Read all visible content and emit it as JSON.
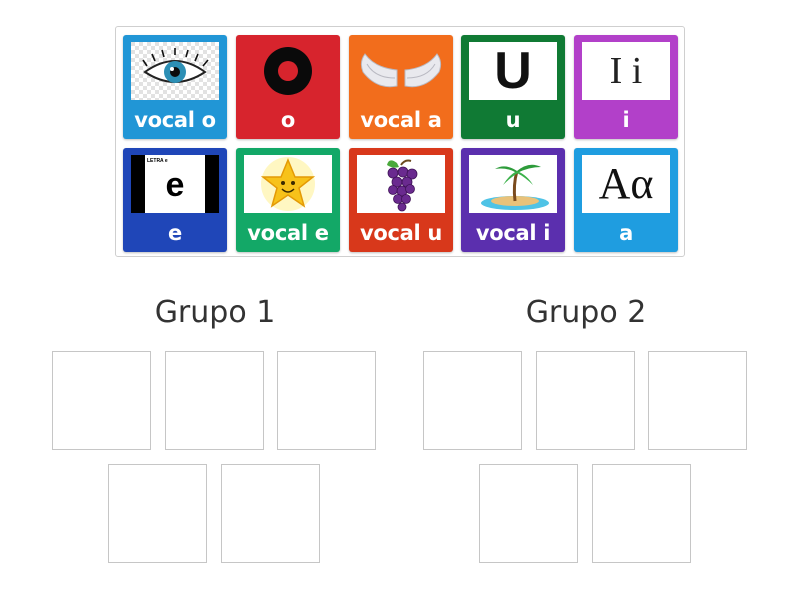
{
  "tiles": [
    {
      "label": "vocal o",
      "color": "#2196d6",
      "icon": "eye-icon"
    },
    {
      "label": "o",
      "color": "#d7242d",
      "icon": "letter-o-ring-icon"
    },
    {
      "label": "vocal a",
      "color": "#f26d1c",
      "icon": "angel-wings-icon"
    },
    {
      "label": "u",
      "color": "#107a34",
      "icon": "letter-u-icon",
      "glyph": "U"
    },
    {
      "label": "i",
      "color": "#b240c9",
      "icon": "letter-i-icon",
      "glyph": "I i"
    },
    {
      "label": "e",
      "color": "#1f46b8",
      "icon": "letter-e-card-icon",
      "glyph": "e",
      "small_text": "LETRA e"
    },
    {
      "label": "vocal e",
      "color": "#13a867",
      "icon": "star-icon"
    },
    {
      "label": "vocal u",
      "color": "#d8381b",
      "icon": "grapes-icon"
    },
    {
      "label": "vocal i",
      "color": "#5b2fae",
      "icon": "palm-island-icon"
    },
    {
      "label": "a",
      "color": "#1f9de0",
      "icon": "letter-a-alpha-icon",
      "glyph": "Aα"
    }
  ],
  "groups": [
    {
      "title": "Grupo 1",
      "slots": 5
    },
    {
      "title": "Grupo 2",
      "slots": 5
    }
  ]
}
